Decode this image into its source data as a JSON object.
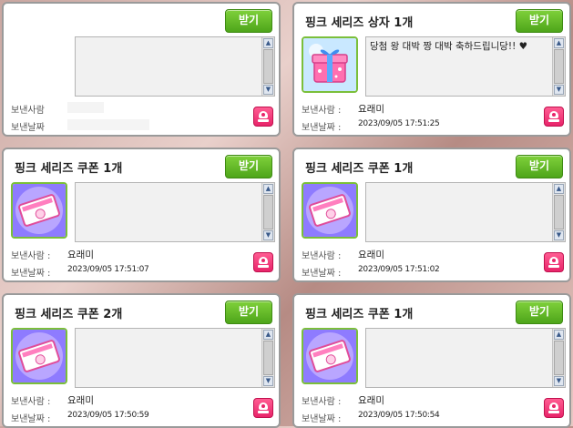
{
  "cards": [
    {
      "title": "",
      "receive_label": "받기",
      "icon": "none",
      "message": "",
      "sender_label": "보낸사람",
      "sender": "",
      "date_label": "보낸날짜",
      "date": ""
    },
    {
      "title": "핑크 세리즈 상자 1개",
      "receive_label": "받기",
      "icon": "pink-gift-box-icon",
      "message": "당첨 왕 대박 짱 대박 축하드립니당!! ♥",
      "sender_label": "보낸사람 :",
      "sender": "요래미",
      "date_label": "보낸날짜 :",
      "date": "2023/09/05 17:51:25"
    },
    {
      "title": "핑크 세리즈 쿠폰 1개",
      "receive_label": "받기",
      "icon": "pink-coupon-icon",
      "message": "",
      "sender_label": "보낸사람 :",
      "sender": "요래미",
      "date_label": "보낸날짜 :",
      "date": "2023/09/05 17:51:07"
    },
    {
      "title": "핑크 세리즈 쿠폰 1개",
      "receive_label": "받기",
      "icon": "pink-coupon-icon",
      "message": "",
      "sender_label": "보낸사람 :",
      "sender": "요래미",
      "date_label": "보낸날짜 :",
      "date": "2023/09/05 17:51:02"
    },
    {
      "title": "핑크 세리즈 쿠폰 2개",
      "receive_label": "받기",
      "icon": "pink-coupon-icon",
      "message": "",
      "sender_label": "보낸사람 :",
      "sender": "요래미",
      "date_label": "보낸날짜 :",
      "date": "2023/09/05 17:50:59"
    },
    {
      "title": "핑크 세리즈 쿠폰 1개",
      "receive_label": "받기",
      "icon": "pink-coupon-icon",
      "message": "",
      "sender_label": "보낸사람 :",
      "sender": "요래미",
      "date_label": "보낸날짜 :",
      "date": "2023/09/05 17:50:54"
    }
  ],
  "colors": {
    "receive_button": "#5cb82a",
    "delete_button": "#e8246a",
    "icon_border": "#7bbf3a"
  }
}
